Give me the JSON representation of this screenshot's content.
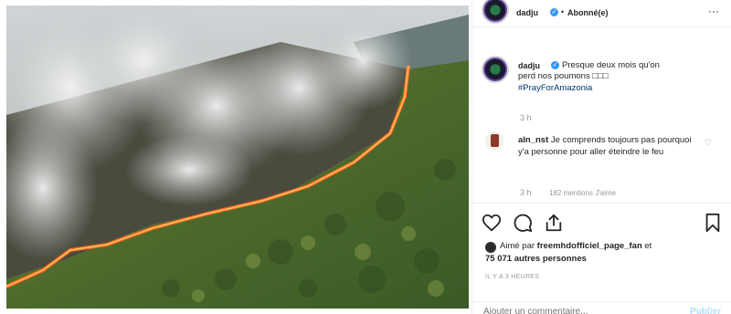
{
  "post": {
    "author": {
      "username": "dadju",
      "verified_icon": "verified-badge-icon",
      "follow_separator": "•",
      "follow_status": "Abonné(e)"
    },
    "more_icon": "more-options-icon",
    "more_glyph": "···",
    "caption": {
      "username": "dadju",
      "text_line1": "Presque deux mois qu'on",
      "text_line2": "perd nos poumons □□□",
      "hashtag": "#PrayForAmazonia",
      "time": "3 h"
    },
    "comments": [
      {
        "username": "aln_nst",
        "text": "Je comprends toujours pas pourquoi y'a personne pour aller éteindre le feu",
        "time": "3 h",
        "likes": "182 mentions J'aime",
        "reply": ""
      }
    ],
    "actions": {
      "like_icon": "heart-icon",
      "comment_icon": "comment-icon",
      "share_icon": "share-icon",
      "save_icon": "bookmark-icon"
    },
    "likes": {
      "prefix": "Aimé par ",
      "user": "freemhdofficiel_page_fan",
      "conjunction": " et",
      "count": "75 071 autres personnes"
    },
    "posted_ago": "IL Y A 3 HEURES",
    "add_comment": {
      "placeholder": "Ajouter un commentaire...",
      "post_label": "Publier"
    },
    "colors": {
      "link": "#003569",
      "verified": "#3897f0",
      "muted": "#999999",
      "post_disabled": "#b2dffc"
    }
  }
}
